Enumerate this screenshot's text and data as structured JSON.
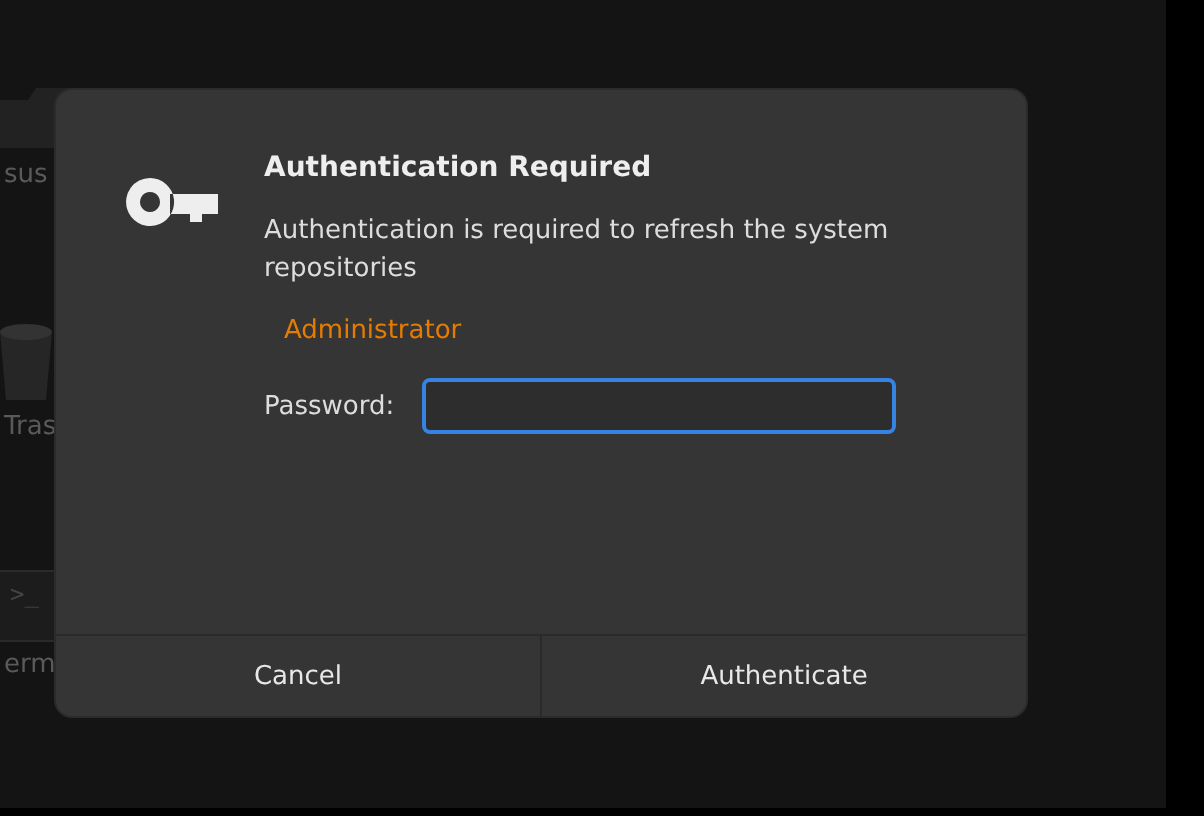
{
  "desktop": {
    "icons": [
      {
        "kind": "folder",
        "label": "sus"
      },
      {
        "kind": "trash",
        "label": "Tras"
      },
      {
        "kind": "terminal",
        "label": "erm",
        "glyph": ">_"
      }
    ]
  },
  "dialog": {
    "title": "Authentication Required",
    "message": "Authentication is required to refresh the system repositories",
    "user": "Administrator",
    "password": {
      "label": "Password:",
      "focused": true
    },
    "buttons": [
      {
        "label": "Cancel"
      },
      {
        "label": "Authenticate"
      }
    ]
  }
}
